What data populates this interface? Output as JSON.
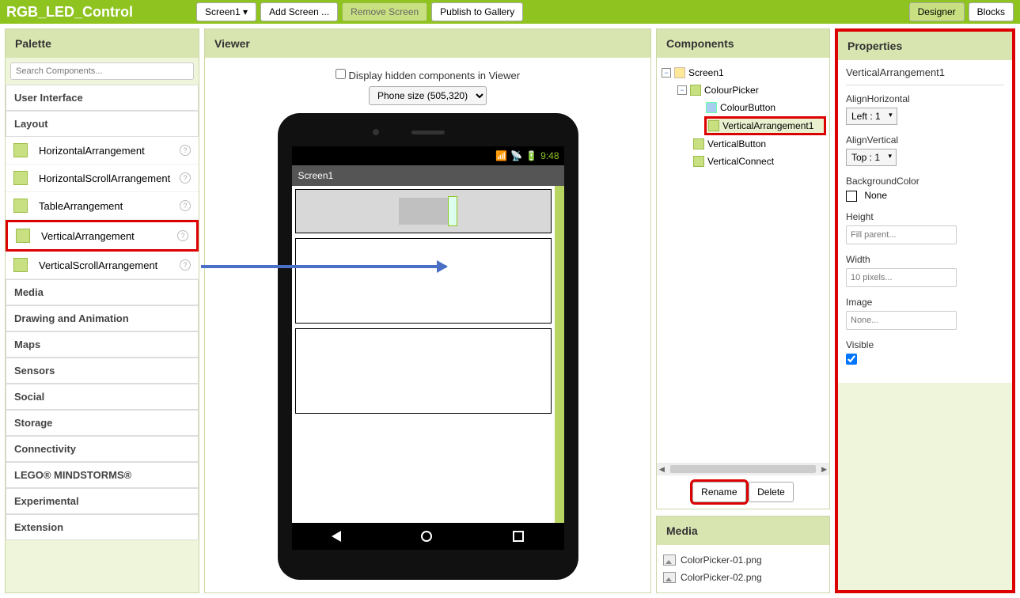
{
  "topbar": {
    "app_title": "RGB_LED_Control",
    "screen_dropdown": "Screen1",
    "add_screen": "Add Screen ...",
    "remove_screen": "Remove Screen",
    "publish": "Publish to Gallery",
    "designer": "Designer",
    "blocks": "Blocks"
  },
  "palette": {
    "title": "Palette",
    "search_placeholder": "Search Components...",
    "categories": {
      "user_interface": "User Interface",
      "layout": "Layout",
      "media": "Media",
      "drawing": "Drawing and Animation",
      "maps": "Maps",
      "sensors": "Sensors",
      "social": "Social",
      "storage": "Storage",
      "connectivity": "Connectivity",
      "lego": "LEGO® MINDSTORMS®",
      "experimental": "Experimental",
      "extension": "Extension"
    },
    "layout_items": {
      "horizontal": "HorizontalArrangement",
      "horizontal_scroll": "HorizontalScrollArrangement",
      "table": "TableArrangement",
      "vertical": "VerticalArrangement",
      "vertical_scroll": "VerticalScrollArrangement"
    }
  },
  "viewer": {
    "title": "Viewer",
    "hidden_checkbox_label": "Display hidden components in Viewer",
    "size_select": "Phone size (505,320)",
    "status_time": "9:48",
    "screen_title": "Screen1"
  },
  "components": {
    "title": "Components",
    "tree": {
      "screen1": "Screen1",
      "colour_picker": "ColourPicker",
      "colour_button": "ColourButton",
      "vertical_arrangement1": "VerticalArrangement1",
      "vertical_button": "VerticalButton",
      "vertical_connect": "VerticalConnect"
    },
    "rename": "Rename",
    "delete": "Delete"
  },
  "media": {
    "title": "Media",
    "items": {
      "pic1": "ColorPicker-01.png",
      "pic2": "ColorPicker-02.png"
    }
  },
  "properties": {
    "title": "Properties",
    "component_name": "VerticalArrangement1",
    "fields": {
      "align_horizontal": {
        "label": "AlignHorizontal",
        "value": "Left : 1"
      },
      "align_vertical": {
        "label": "AlignVertical",
        "value": "Top : 1"
      },
      "background_color": {
        "label": "BackgroundColor",
        "value": "None"
      },
      "height": {
        "label": "Height",
        "value": "Fill parent..."
      },
      "width": {
        "label": "Width",
        "value": "10 pixels..."
      },
      "image": {
        "label": "Image",
        "value": "None..."
      },
      "visible": {
        "label": "Visible"
      }
    }
  }
}
